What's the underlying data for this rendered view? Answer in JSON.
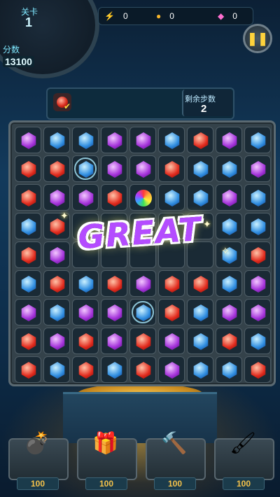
{
  "hud": {
    "level_label": "关卡",
    "level_value": "1",
    "score_label": "分数",
    "score_value": "13100",
    "resources": [
      {
        "icon": "lightning-icon",
        "value": "0"
      },
      {
        "icon": "gold-coin-icon",
        "value": "0"
      },
      {
        "icon": "pink-gem-icon",
        "value": "0"
      }
    ],
    "pause_icon": "pause-icon"
  },
  "goal": {
    "target_gem": "red",
    "completed": true,
    "moves_label": "剩余步数",
    "moves_value": "2"
  },
  "board": {
    "rows": 9,
    "cols": 9,
    "grid": [
      [
        "purple",
        "blue",
        "blue",
        "purple",
        "purple",
        "blue",
        "red",
        "purple",
        "blue"
      ],
      [
        "red",
        "red",
        "blue-bubble",
        "purple",
        "purple",
        "red",
        "blue",
        "blue",
        "purple"
      ],
      [
        "red",
        "purple",
        "purple",
        "red",
        "rainbow",
        "blue",
        "blue",
        "purple",
        "blue"
      ],
      [
        "blue",
        "red",
        "",
        "",
        "",
        "",
        "",
        "blue",
        "blue"
      ],
      [
        "red",
        "purple",
        "",
        "",
        "",
        "",
        "",
        "blue",
        "red"
      ],
      [
        "blue",
        "red",
        "blue",
        "red",
        "purple",
        "red",
        "red",
        "blue",
        "purple"
      ],
      [
        "purple",
        "blue",
        "purple",
        "purple",
        "blue-bubble",
        "red",
        "blue",
        "purple",
        "purple"
      ],
      [
        "red",
        "purple",
        "red",
        "purple",
        "red",
        "purple",
        "blue",
        "red",
        "blue"
      ],
      [
        "red",
        "blue",
        "red",
        "blue",
        "red",
        "purple",
        "blue",
        "blue",
        "red"
      ]
    ]
  },
  "banner": {
    "text": "GREAT"
  },
  "boosters": [
    {
      "name": "bomb",
      "icon": "bomb-icon",
      "count": "100"
    },
    {
      "name": "swap",
      "icon": "gem-box-icon",
      "count": "100"
    },
    {
      "name": "hammer",
      "icon": "hammer-icon",
      "count": "100"
    },
    {
      "name": "brush",
      "icon": "brush-icon",
      "count": "100"
    }
  ]
}
